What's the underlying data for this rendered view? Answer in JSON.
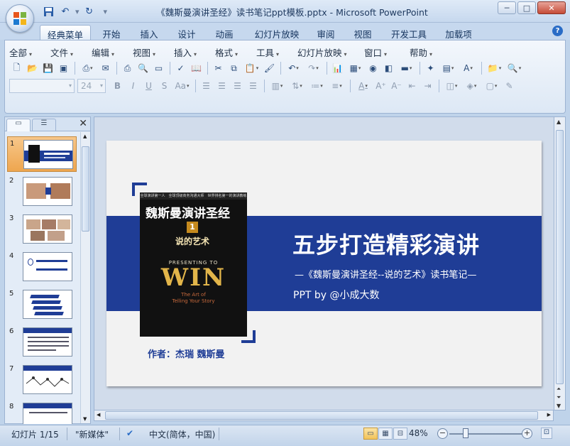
{
  "window": {
    "title": "《魏斯曼演讲圣经》读书笔记ppt模板.pptx - Microsoft PowerPoint",
    "minimize": "─",
    "maximize": "□",
    "close": "✕"
  },
  "ribbon_tabs": [
    "经典菜单",
    "开始",
    "插入",
    "设计",
    "动画",
    "幻灯片放映",
    "审阅",
    "视图",
    "开发工具",
    "加载项"
  ],
  "menus": [
    "全部",
    "文件",
    "编辑",
    "视图",
    "插入",
    "格式",
    "工具",
    "幻灯片放映",
    "窗口",
    "帮助"
  ],
  "font": {
    "name": "",
    "size": "24"
  },
  "thumbnails": [
    "1",
    "2",
    "3",
    "4",
    "5",
    "6",
    "7",
    "8"
  ],
  "slide": {
    "title": "五步打造精彩演讲",
    "subtitle": "—《魏斯曼演讲圣经--说的艺术》读书笔记—",
    "ppt_by": "PPT by @小成大数",
    "author": "作者：杰瑞 魏斯曼",
    "book": {
      "top_line": "全球演讲第一人　全球顶级商务沟通大师　世界排名第一的演讲教练",
      "title": "魏斯曼演讲圣经",
      "volume": "1",
      "subtitle": "说的艺术",
      "presenting": "PRESENTING TO",
      "win": "WIN",
      "art": "The Art of\nTelling Your Story"
    }
  },
  "status": {
    "slide": "幻灯片 1/15",
    "theme": "\"新媒体\"",
    "language": "中文(简体，中国)",
    "zoom": "48%"
  },
  "colors": {
    "accent_blue": "#1f3d96",
    "book_gold": "#e2b54a"
  }
}
